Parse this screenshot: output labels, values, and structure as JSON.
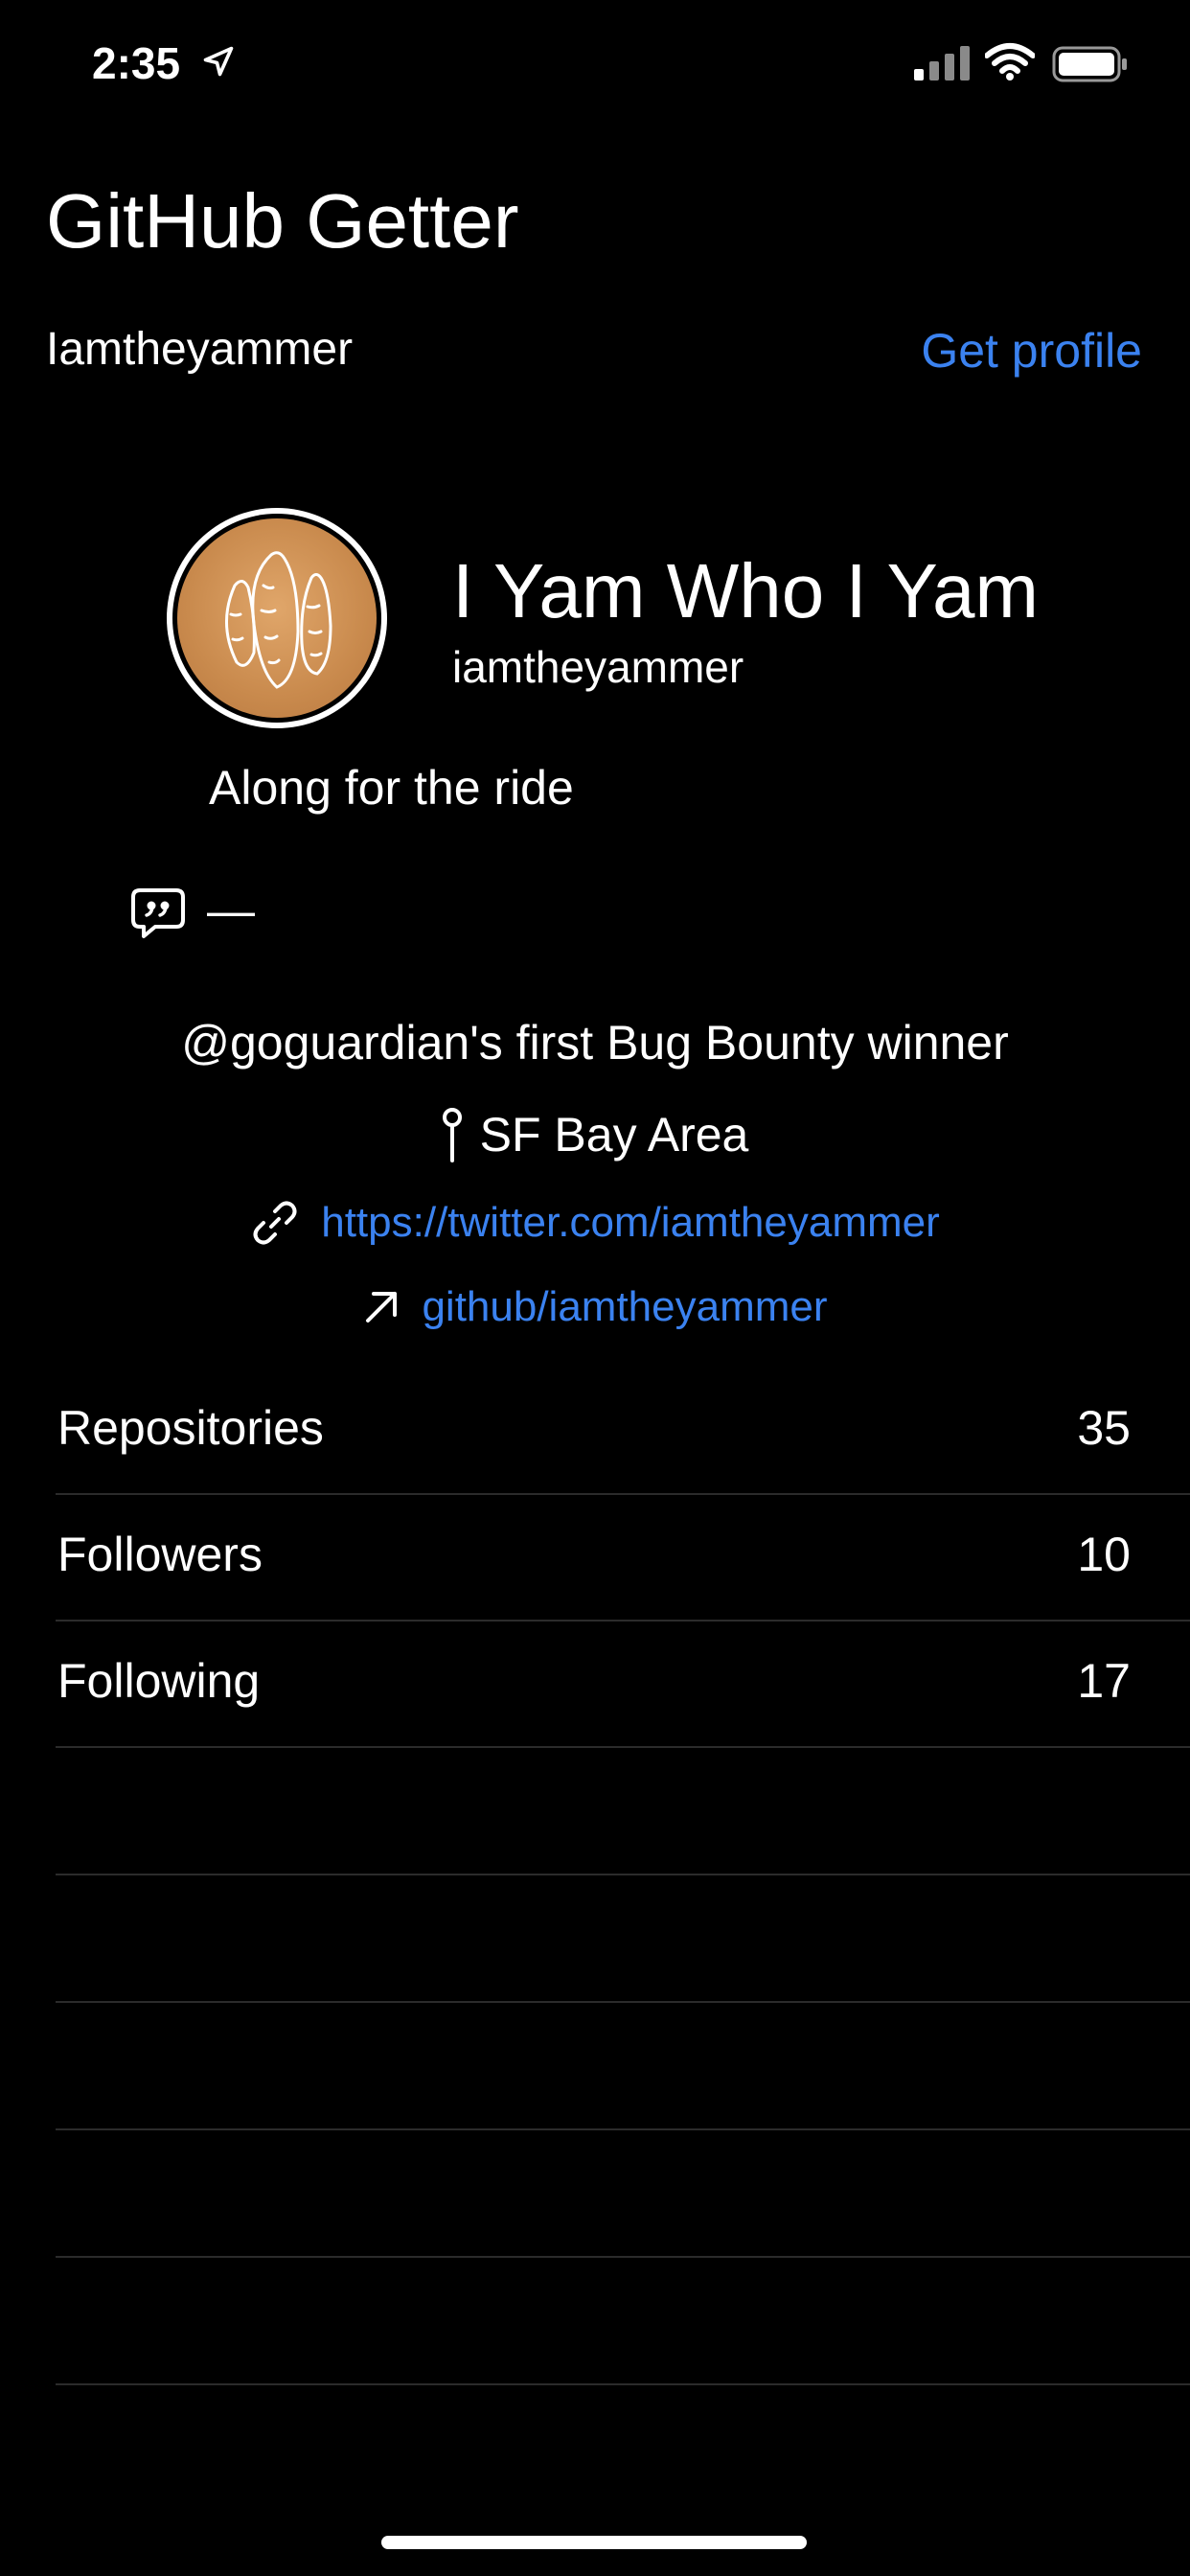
{
  "status_bar": {
    "time": "2:35",
    "icons": [
      "location-arrow-icon",
      "cellular-signal-icon",
      "wifi-icon",
      "battery-icon"
    ]
  },
  "header": {
    "title": "GitHub Getter",
    "username_value": "Iamtheyammer",
    "get_profile_label": "Get profile"
  },
  "profile": {
    "display_name": "I Yam Who I Yam",
    "handle": "iamtheyammer",
    "status_message": "Along for the ride",
    "quote_text": "—",
    "bio": "@goguardian's first Bug Bounty winner",
    "location": "SF Bay Area",
    "website": "https://twitter.com/iamtheyammer",
    "github_link": "github/iamtheyammer",
    "avatar_icon": "yam-avatar"
  },
  "stats": [
    {
      "label": "Repositories",
      "value": "35"
    },
    {
      "label": "Followers",
      "value": "10"
    },
    {
      "label": "Following",
      "value": "17"
    }
  ],
  "colors": {
    "background": "#000000",
    "text": "#ffffff",
    "accent": "#3b82f0",
    "separator": "#2b2b2b",
    "avatar": "#c98a4d"
  }
}
